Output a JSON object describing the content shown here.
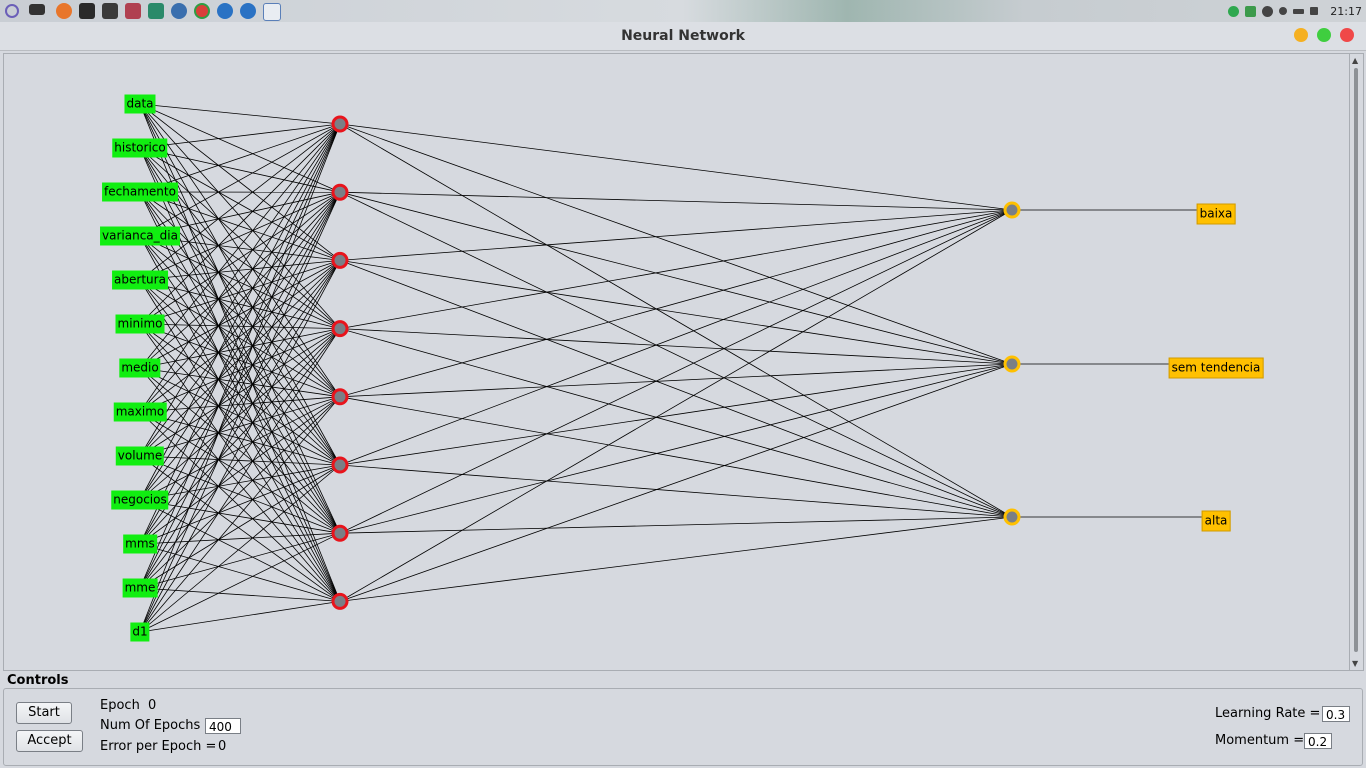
{
  "taskbar": {
    "icons": [
      "launcher-icon",
      "desktop-icon",
      "firefox-icon",
      "files-icon",
      "folder-icon",
      "monitor-icon",
      "app-icon",
      "app-icon-2",
      "chrome-icon",
      "telegram-icon",
      "telegram-icon-2",
      "java-icon"
    ],
    "tray": [
      "whatsapp-icon",
      "shield-icon",
      "bluetooth-icon",
      "info-icon",
      "battery-icon",
      "volume-icon"
    ],
    "clock": "21:17"
  },
  "window": {
    "title": "Neural Network",
    "buttons": {
      "minimize_color": "#f5b021",
      "maximize_color": "#3fce3f",
      "close_color": "#f04848"
    }
  },
  "network": {
    "input_color": "#11ee11",
    "hidden_color": "#e8141c",
    "output_color": "#ffc000",
    "inputs": [
      "data",
      "historico",
      "fechamento",
      "varianca_dia",
      "abertura",
      "minimo",
      "medio",
      "maximo",
      "volume",
      "negocios",
      "mms",
      "mme",
      "d1"
    ],
    "hidden_count": 8,
    "outputs": [
      "baixa",
      "sem tendencia",
      "alta"
    ]
  },
  "controls": {
    "title": "Controls",
    "start_label": "Start",
    "accept_label": "Accept",
    "epoch_label": "Epoch",
    "epoch_value": "0",
    "num_epochs_label": "Num Of Epochs",
    "num_epochs_value": "400",
    "error_label": "Error per Epoch =",
    "error_value": "0",
    "learning_rate_label": "Learning Rate =",
    "learning_rate_value": "0.3",
    "momentum_label": "Momentum =",
    "momentum_value": "0.2"
  }
}
